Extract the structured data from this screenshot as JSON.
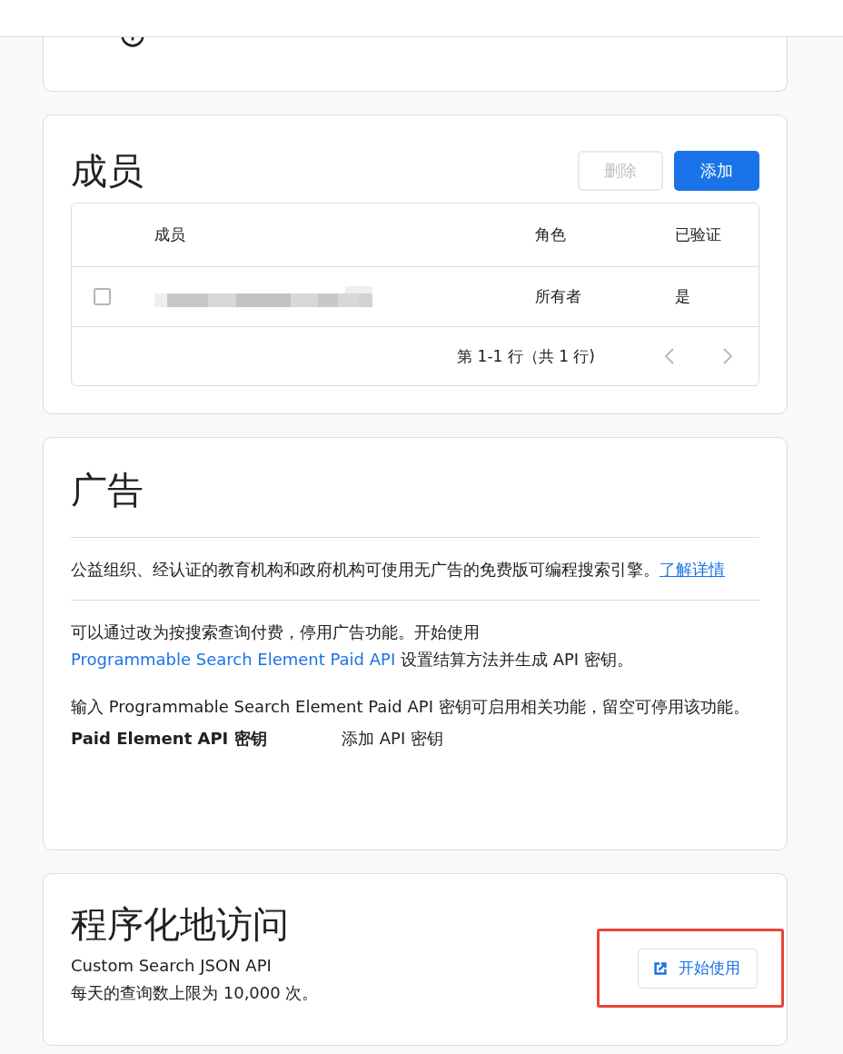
{
  "members": {
    "title": "成员",
    "buttons": [
      {
        "label": "删除",
        "kind": "secondary",
        "disabled": true
      },
      {
        "label": "添加",
        "kind": "primary",
        "disabled": false
      }
    ],
    "table": {
      "columns": [
        "成员",
        "角色",
        "已验证"
      ],
      "rows": [
        {
          "checked": false,
          "role": "所有者",
          "verified": "是"
        }
      ],
      "pagination": {
        "text": "第 1-1 行（共 1 行)",
        "prev_disabled": true,
        "next_disabled": true
      }
    }
  },
  "ads": {
    "title": "广告",
    "paragraphs": [
      {
        "text": "公益组织、经认证的教育机构和政府机构可使用无广告的免费版可编程搜索引擎。",
        "link": "了解详情"
      },
      {
        "text": "可以通过改为按搜索查询付费，停用广告功能。开始使用 ",
        "link": "Programmable Search Element Paid API",
        "after": " 设置结算方法并生成 API 密钥。"
      }
    ],
    "note": "输入 Programmable Search Element Paid API 密钥可启用相关功能，留空可停用该功能。",
    "key_row": {
      "label": "Paid Element API 密钥",
      "value": "添加 API 密钥"
    }
  },
  "access": {
    "title": "程序化地访问",
    "lines": [
      "Custom Search JSON API",
      "每天的查询数上限为 10,000 次。"
    ],
    "button": "开始使用",
    "highlighted": true
  }
}
